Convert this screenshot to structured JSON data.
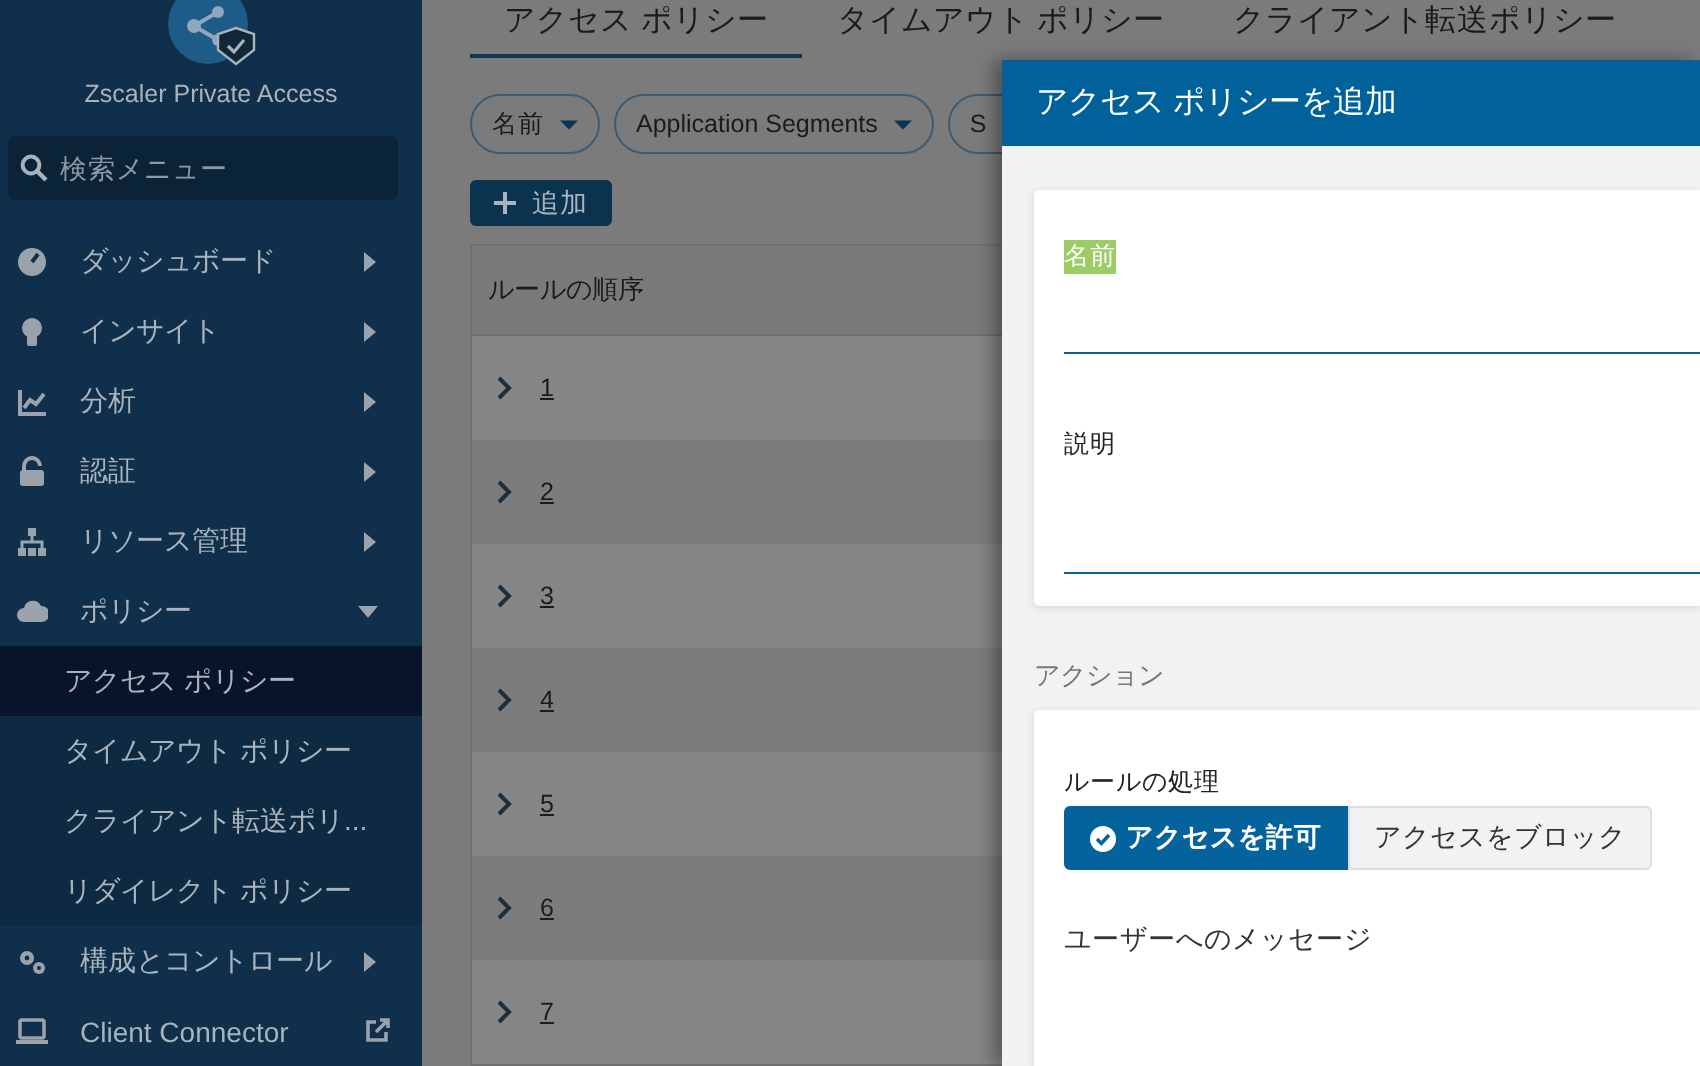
{
  "sidebar": {
    "title": "Zscaler Private Access",
    "search": {
      "placeholder": "検索メニュー"
    },
    "items": [
      {
        "kind": "menu",
        "label": "ダッシュボード",
        "expanded": false
      },
      {
        "kind": "menu",
        "label": "インサイト",
        "expanded": false
      },
      {
        "kind": "menu",
        "label": "分析",
        "expanded": false
      },
      {
        "kind": "menu",
        "label": "認証",
        "expanded": false
      },
      {
        "kind": "menu",
        "label": "リソース管理",
        "expanded": false
      },
      {
        "kind": "menu",
        "label": "ポリシー",
        "expanded": true,
        "children": [
          {
            "label": "アクセス ポリシー",
            "selected": true
          },
          {
            "label": "タイムアウト ポリシー",
            "selected": false
          },
          {
            "label": "クライアント転送ポリ...",
            "selected": false
          },
          {
            "label": "リダイレクト ポリシー",
            "selected": false
          }
        ]
      },
      {
        "kind": "menu",
        "label": "構成とコントロール",
        "expanded": false
      },
      {
        "kind": "external",
        "label": "Client Connector"
      }
    ]
  },
  "tabs": [
    {
      "label": "アクセス ポリシー",
      "selected": true
    },
    {
      "label": "タイムアウト ポリシー",
      "selected": false
    },
    {
      "label": "クライアント転送ポリシー",
      "selected": false
    }
  ],
  "filters": [
    {
      "label": "名前"
    },
    {
      "label": "Application Segments"
    },
    {
      "label": "S"
    }
  ],
  "add_button": {
    "label": "追加"
  },
  "table": {
    "columns": [
      "ルールの順序"
    ],
    "rows": [
      "1",
      "2",
      "3",
      "4",
      "5",
      "6",
      "7"
    ]
  },
  "panel": {
    "title": "アクセス ポリシーを追加",
    "fields": [
      {
        "label": "名前",
        "highlighted": true
      },
      {
        "label": "説明",
        "highlighted": false
      }
    ],
    "section_label": "アクション",
    "rule_action": {
      "label": "ルールの処理",
      "options": [
        {
          "label": "アクセスを許可",
          "selected": true
        },
        {
          "label": "アクセスをブロック",
          "selected": false
        }
      ]
    },
    "message_label": "ユーザーへのメッセージ"
  }
}
